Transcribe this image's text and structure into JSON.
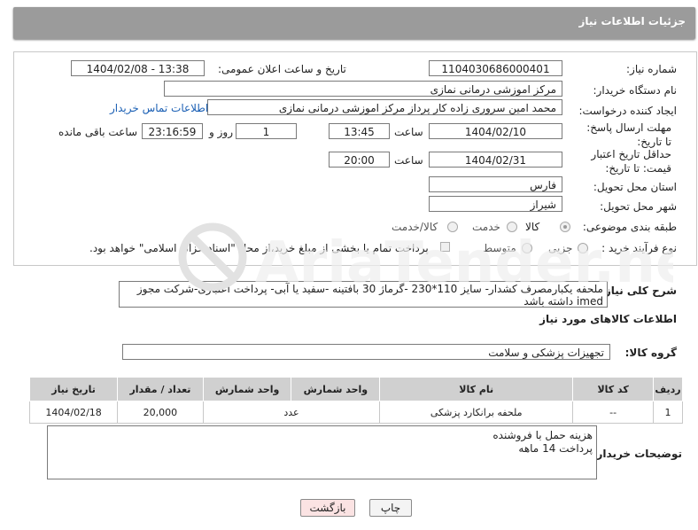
{
  "header": {
    "title": "جزئیات اطلاعات نیاز"
  },
  "form": {
    "need_number_label": "شماره نیاز:",
    "need_number": "1104030686000401",
    "announce_label": "تاریخ و ساعت اعلان عمومی:",
    "announce_value": "1404/02/08 - 13:38",
    "buyer_org_label": "نام دستگاه خریدار:",
    "buyer_org": "مرکز اموزشی درمانی نمازی",
    "creator_label": "ایجاد کننده درخواست:",
    "creator": "محمد امین سروری زاده کار پرداز مرکز اموزشی درمانی نمازی",
    "contact_link": "اطلاعات تماس خریدار",
    "deadline_label": "مهلت ارسال پاسخ: تا تاریخ:",
    "deadline_date": "1404/02/10",
    "time_label": "ساعت",
    "deadline_time": "13:45",
    "days_value": "1",
    "days_label": "روز و",
    "remaining_time": "23:16:59",
    "remaining_label": "ساعت باقی مانده",
    "price_validity_label": "حداقل تاریخ اعتبار قیمت: تا تاریخ:",
    "price_validity_date": "1404/02/31",
    "price_validity_time": "20:00",
    "province_label": "استان محل تحویل:",
    "province": "فارس",
    "city_label": "شهر محل تحویل:",
    "city": "شیراز",
    "category_label": "طبقه بندی موضوعی:",
    "category_options": [
      "کالا",
      "خدمت",
      "کالا/خدمت"
    ],
    "category_selected": "کالا",
    "process_label": "نوع فرآیند خرید :",
    "process_options": [
      "جزیی",
      "متوسط"
    ],
    "process_note": "پرداخت تمام یا بخشی از مبلغ خرید،از محل \"اسناد خزانه اسلامی\" خواهد بود."
  },
  "description": {
    "label": "شرح کلی نیاز:",
    "text": "ملحفه یکبارمصرف کشدار- سایز 110*230 -گرماژ 30 بافتینه -سفید یا آبی- پرداخت اعتباری-شرکت مجوز imed داشته باشد"
  },
  "goods": {
    "section_title": "اطلاعات کالاهای مورد نیاز",
    "group_label": "گروه کالا:",
    "group_value": "تجهیزات پزشکی و سلامت",
    "columns": [
      "ردیف",
      "کد کالا",
      "نام کالا",
      "واحد شمارش",
      "تعداد / مقدار",
      "تاریخ نیاز"
    ],
    "rows": [
      {
        "row": "1",
        "code": "--",
        "name": "ملحفه برانکارد پزشکی",
        "unit": "عدد",
        "qty": "20,000",
        "date": "1404/02/18"
      }
    ]
  },
  "buyer_notes": {
    "label": "توضیحات خریدار:",
    "line1": "هزینه حمل با فروشنده",
    "line2": "پرداخت 14 ماهه"
  },
  "buttons": {
    "print": "چاپ",
    "back": "بازگشت"
  },
  "watermark": {
    "text": "AriaTender.neT"
  },
  "colors": {
    "header_bg": "#9b9b9b",
    "link": "#1a5fb4",
    "back_button_bg": "#fbe3e3",
    "print_button_bg": "#f4f4f4"
  }
}
